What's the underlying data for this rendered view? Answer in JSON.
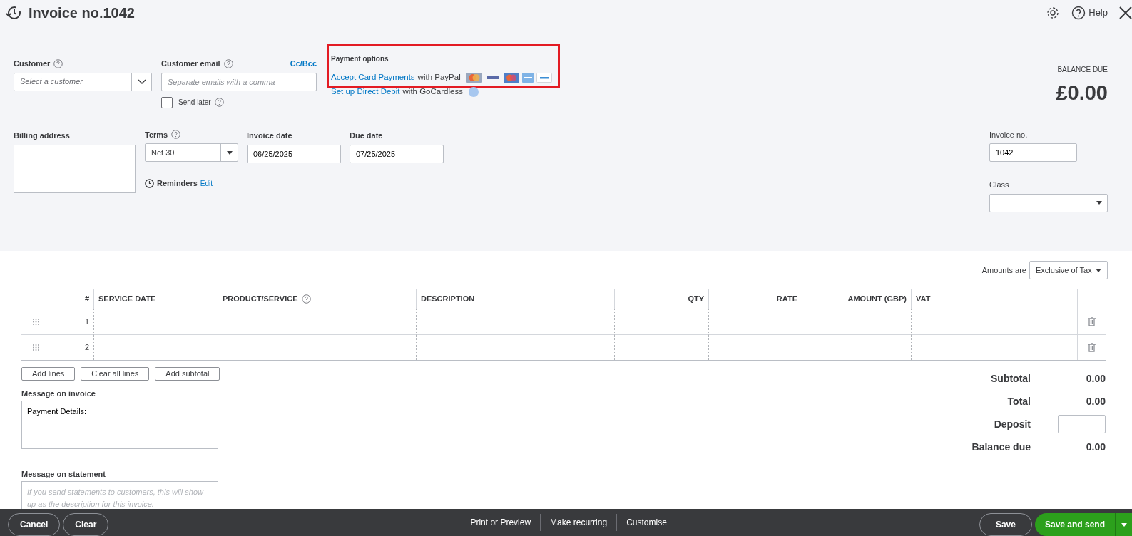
{
  "header": {
    "title": "Invoice no.1042",
    "help": "Help"
  },
  "customer": {
    "label": "Customer",
    "placeholder": "Select a customer"
  },
  "email": {
    "label": "Customer email",
    "placeholder": "Separate emails with a comma",
    "cc_bcc": "Cc/Bcc"
  },
  "send_later": {
    "label": "Send later",
    "checked": false
  },
  "payment_options": {
    "title": "Payment options",
    "highlighted": true,
    "card_link": "Accept Card Payments",
    "card_suffix": "with PayPal",
    "debit_link": "Set up Direct Debit",
    "debit_suffix": "with GoCardless"
  },
  "balance": {
    "label": "BALANCE DUE",
    "amount": "£0.00"
  },
  "billing_address": {
    "label": "Billing address"
  },
  "terms": {
    "label": "Terms",
    "value": "Net 30"
  },
  "invoice_date": {
    "label": "Invoice date",
    "value": "06/25/2025"
  },
  "due_date": {
    "label": "Due date",
    "value": "07/25/2025"
  },
  "reminders": {
    "label": "Reminders",
    "link": "Edit"
  },
  "invoice_no": {
    "label": "Invoice no.",
    "value": "1042"
  },
  "class_field": {
    "label": "Class"
  },
  "amounts_are": {
    "label": "Amounts are",
    "value": "Exclusive of Tax"
  },
  "table": {
    "columns": [
      {
        "label": "#",
        "kind": "numeric"
      },
      {
        "label": "SERVICE DATE",
        "kind": "text"
      },
      {
        "label": "PRODUCT/SERVICE",
        "kind": "help"
      },
      {
        "label": "DESCRIPTION",
        "kind": "text"
      },
      {
        "label": "QTY",
        "kind": "numeric"
      },
      {
        "label": "RATE",
        "kind": "numeric"
      },
      {
        "label": "AMOUNT (GBP)",
        "kind": "numeric"
      },
      {
        "label": "VAT",
        "kind": "text"
      }
    ],
    "rows": [
      {
        "number": "1"
      },
      {
        "number": "2"
      }
    ]
  },
  "line_buttons": [
    "Add lines",
    "Clear all lines",
    "Add subtotal"
  ],
  "message_invoice": {
    "label": "Message on invoice",
    "value": "Payment Details:"
  },
  "message_statement": {
    "label": "Message on statement",
    "placeholder": "If you send statements to customers, this will show up as the description for this invoice."
  },
  "totals": [
    {
      "kind": "text",
      "label": "Subtotal",
      "value": "0.00"
    },
    {
      "kind": "text",
      "label": "Total",
      "value": "0.00"
    },
    {
      "kind": "input",
      "label": "Deposit"
    },
    {
      "kind": "text",
      "label": "Balance due",
      "value": "0.00"
    }
  ],
  "footer": {
    "left": [
      "Cancel",
      "Clear"
    ],
    "center": [
      "Print or Preview",
      "Make recurring",
      "Customise"
    ],
    "save": "Save",
    "save_send": "Save and send"
  }
}
